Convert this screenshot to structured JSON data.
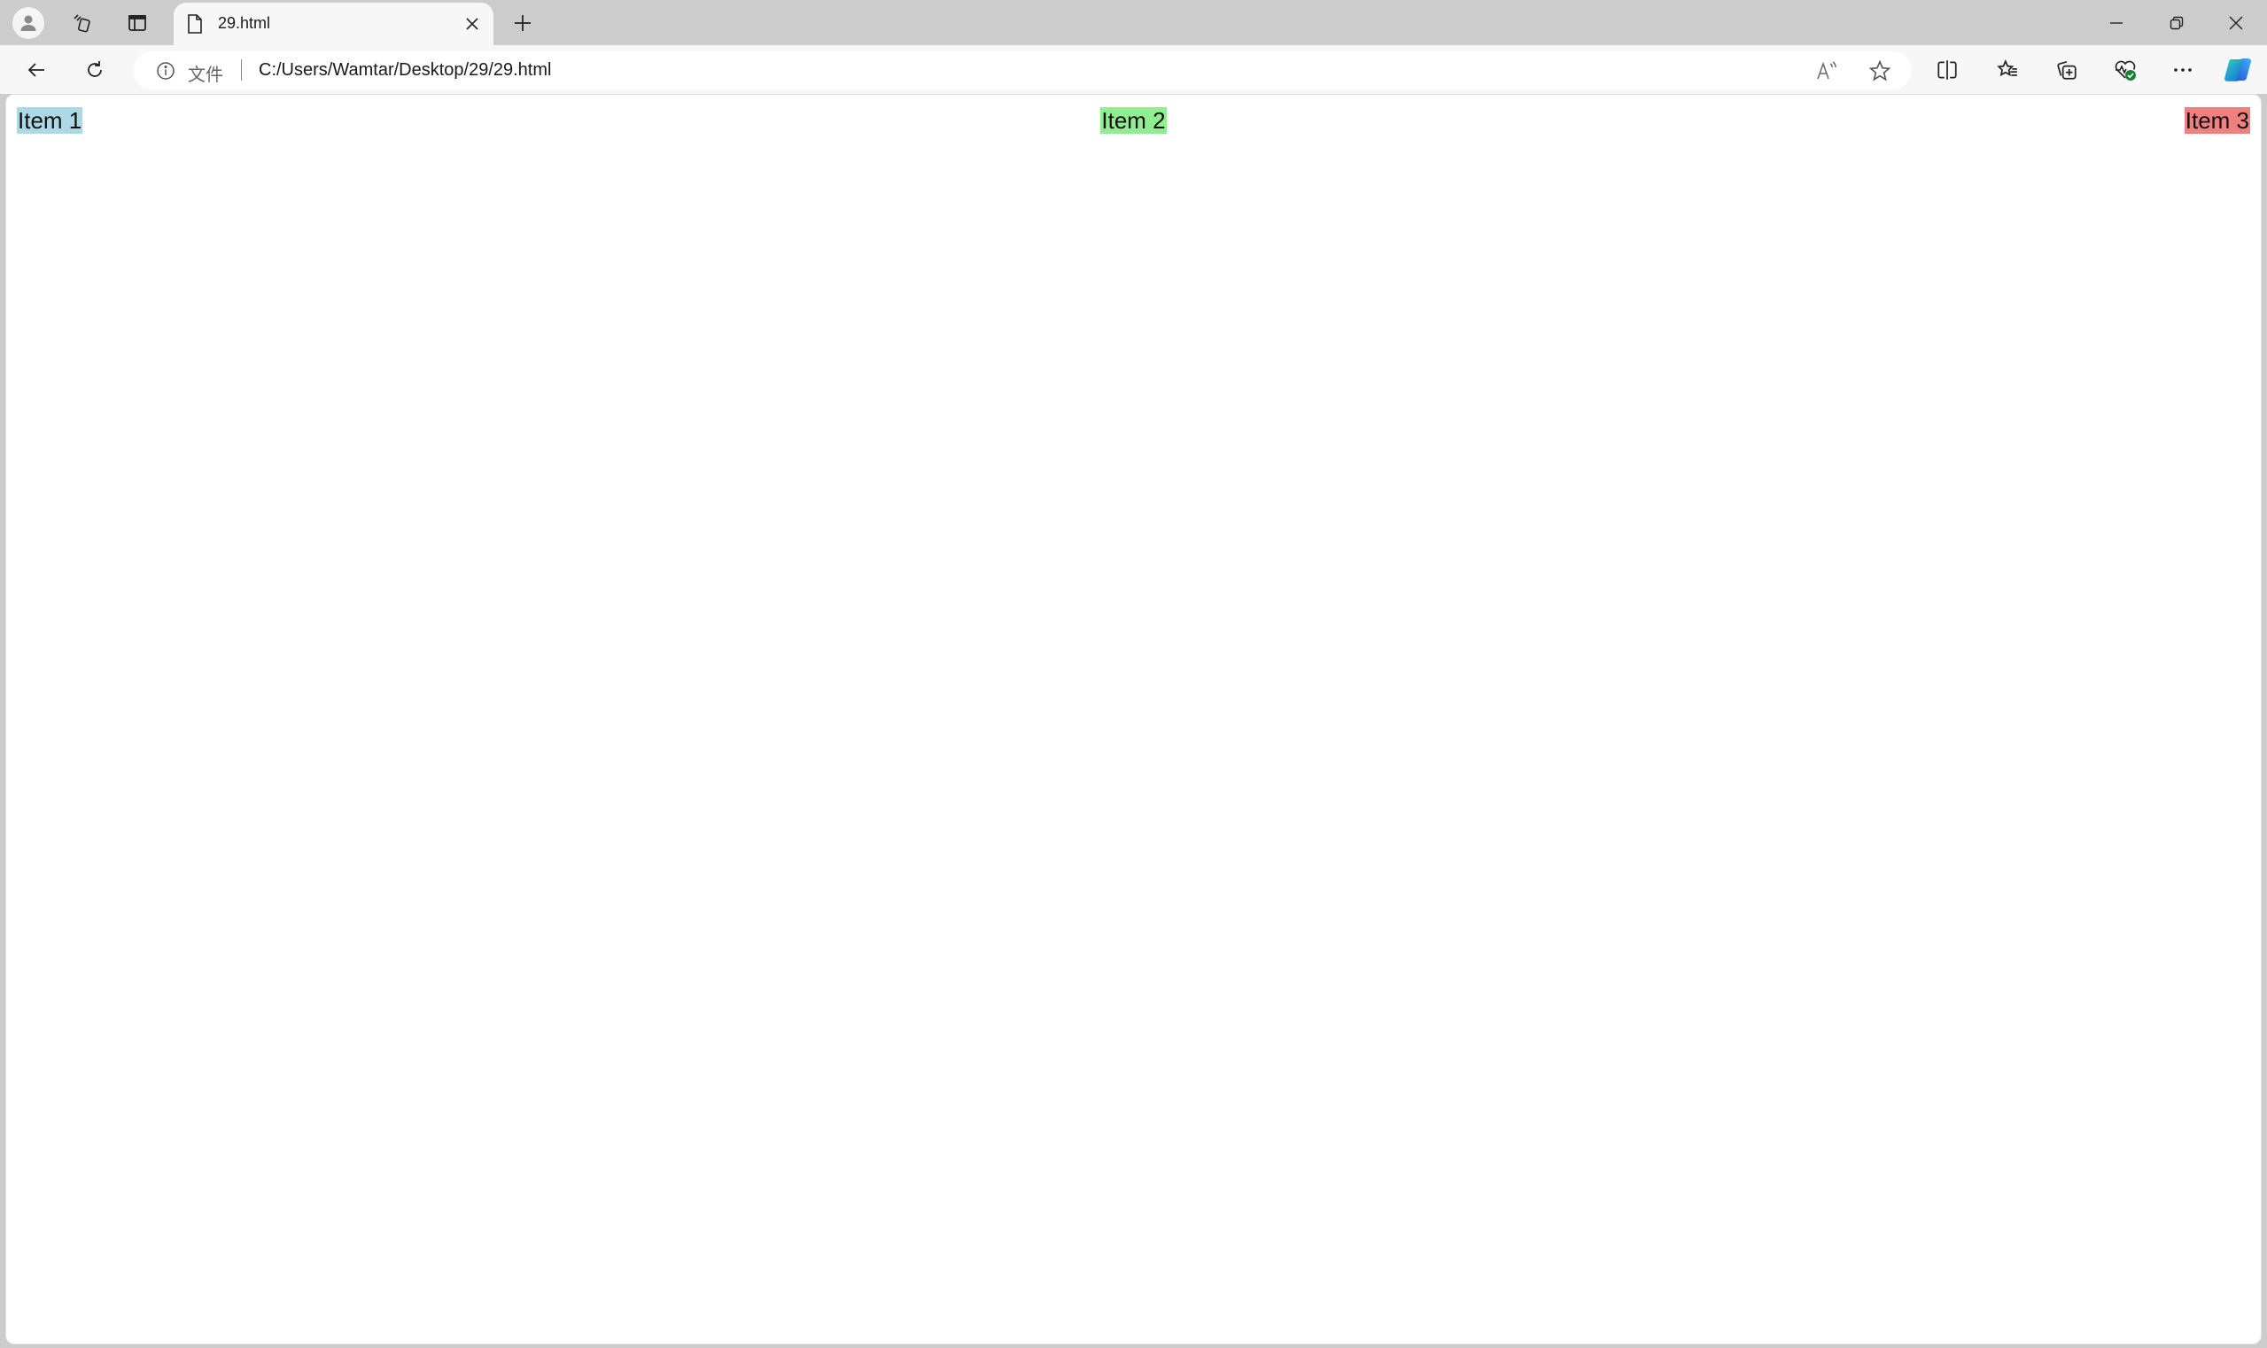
{
  "browser": {
    "tab": {
      "title": "29.html",
      "icon": "file-icon"
    },
    "address_bar": {
      "security_label": "文件",
      "url": "C:/Users/Wamtar/Desktop/29/29.html"
    },
    "icons": {
      "profile": "profile-icon",
      "workspaces": "workspaces-icon",
      "vertical_tabs": "vertical-tabs-icon",
      "new_tab": "plus-icon",
      "back": "back-arrow-icon",
      "refresh": "refresh-icon",
      "read_aloud": "read-aloud-icon",
      "favorite": "star-icon",
      "split_screen": "split-screen-icon",
      "favorites": "favorites-icon",
      "collections": "collections-icon",
      "browser_essentials": "browser-essentials-icon",
      "more": "more-icon",
      "copilot": "copilot-icon"
    }
  },
  "page": {
    "items": [
      {
        "label": "Item 1",
        "color": "#add8e6"
      },
      {
        "label": "Item 2",
        "color": "#90ee90"
      },
      {
        "label": "Item 3",
        "color": "#f08080"
      }
    ]
  }
}
